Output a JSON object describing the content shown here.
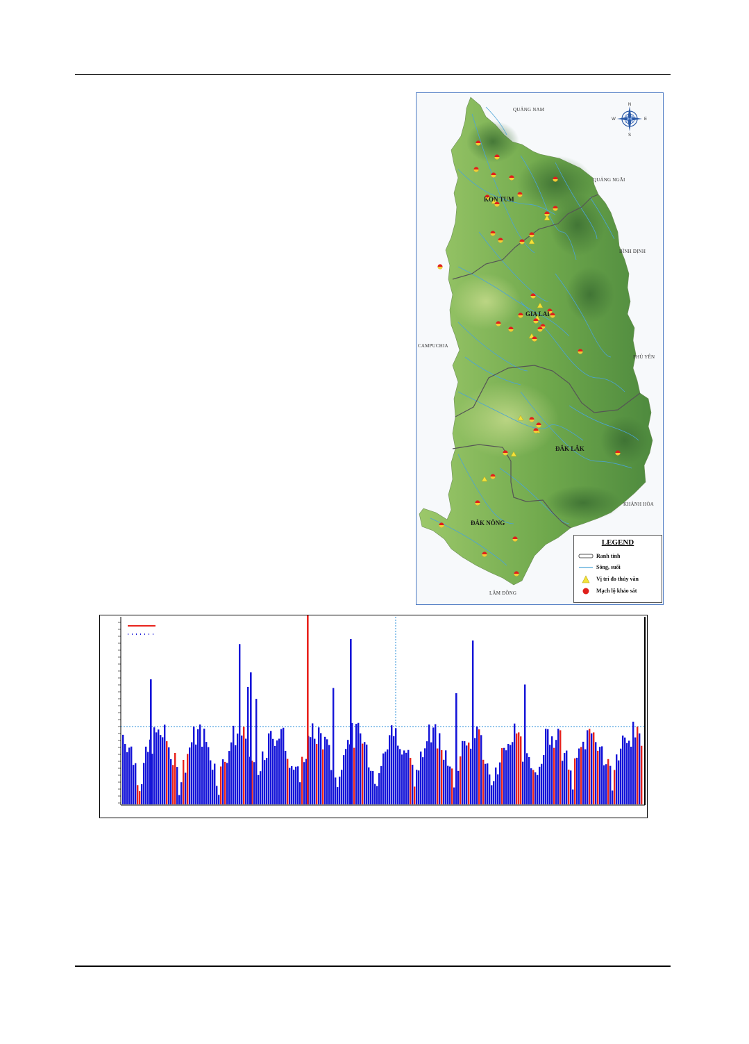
{
  "map": {
    "regions": [
      {
        "id": "quang-nam",
        "label": "QUẢNG NAM"
      },
      {
        "id": "quang-ngai",
        "label": "QUẢNG NGÃI"
      },
      {
        "id": "binh-dinh",
        "label": "BÌNH ĐỊNH"
      },
      {
        "id": "campuchia",
        "label": "CAMPUCHIA"
      },
      {
        "id": "phu-yen",
        "label": "PHÚ YÊN"
      },
      {
        "id": "khanh-hoa",
        "label": "KHÁNH HÒA"
      },
      {
        "id": "lam-dong",
        "label": "LÂM ĐỒNG"
      }
    ],
    "provinces": [
      {
        "id": "kon-tum",
        "label": "KON TUM"
      },
      {
        "id": "gia-lai",
        "label": "GIA LAI"
      },
      {
        "id": "dak-lak",
        "label": "ĐẮK LẮK"
      },
      {
        "id": "dak-nong",
        "label": "ĐẮK NÔNG"
      }
    ],
    "compass": {
      "n": "N",
      "s": "S",
      "e": "E",
      "w": "W"
    },
    "legend": {
      "title": "LEGEND",
      "items": [
        {
          "symbol": "boundary",
          "label": "Ranh tỉnh"
        },
        {
          "symbol": "river",
          "label": "Sông, suối"
        },
        {
          "symbol": "triangle",
          "label": "Vị trí đo thủy văn"
        },
        {
          "symbol": "circle",
          "label": "Mạch lộ khảo sát"
        }
      ]
    },
    "colors": {
      "terrain_low": "#8bbd5e",
      "terrain_high": "#3f7a3a",
      "river": "#4aa3d8",
      "boundary": "#555555",
      "circle": "#e0201c",
      "triangle": "#f3e23a"
    }
  },
  "chart_data": {
    "type": "bar",
    "title": "",
    "xlabel": "",
    "ylabel": "",
    "series": [
      {
        "color": "#e8231c"
      },
      {
        "color": "#1414d8"
      }
    ],
    "colors": {
      "reference_line": "#2a8fd8"
    }
  }
}
